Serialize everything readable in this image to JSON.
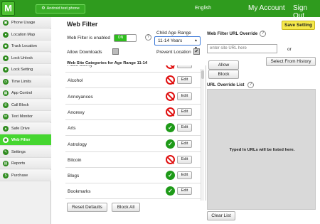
{
  "logo": "M",
  "header": {
    "device": "Android test phone",
    "language": "English",
    "my_account": "My Account",
    "sign_out": "Sign Out"
  },
  "sidebar": {
    "items": [
      {
        "label": "Phone Usage",
        "icon": "phone-icon",
        "glyph": "▣",
        "active": false
      },
      {
        "label": "Location Map",
        "icon": "map-pin-icon",
        "glyph": "●",
        "active": false
      },
      {
        "label": "Track Location",
        "icon": "track-icon",
        "glyph": "◆",
        "active": false
      },
      {
        "label": "Lock Unlock",
        "icon": "lock-icon",
        "glyph": "■",
        "active": false
      },
      {
        "label": "Lock Setting",
        "icon": "lock-setting-icon",
        "glyph": "■",
        "active": false
      },
      {
        "label": "Time Limits",
        "icon": "clock-icon",
        "glyph": "◷",
        "active": false
      },
      {
        "label": "App Control",
        "icon": "app-grid-icon",
        "glyph": "▦",
        "active": false
      },
      {
        "label": "Call Block",
        "icon": "call-block-icon",
        "glyph": "✆",
        "active": false
      },
      {
        "label": "Text Monitor",
        "icon": "text-monitor-icon",
        "glyph": "✉",
        "active": false
      },
      {
        "label": "Safe Drive",
        "icon": "car-icon",
        "glyph": "▲",
        "active": false
      },
      {
        "label": "Web Filter",
        "icon": "web-filter-icon",
        "glyph": "◉",
        "active": true
      },
      {
        "label": "Settings",
        "icon": "wrench-icon",
        "glyph": "✎",
        "active": false
      },
      {
        "label": "Reports",
        "icon": "reports-icon",
        "glyph": "▤",
        "active": false
      },
      {
        "label": "Purchase",
        "icon": "dollar-icon",
        "glyph": "$",
        "active": false
      }
    ]
  },
  "main": {
    "title": "Web Filter",
    "web_filter_enabled_label": "Web Filter is enabled",
    "toggle_on": "ON",
    "allow_downloads_label": "Allow Downloads",
    "allow_downloads_checked": false,
    "age_range_label": "Child Age Range",
    "age_range_value": "11-14 Years",
    "prevent_location_label": "Prevent Location",
    "prevent_location_checked": true,
    "categories_header": "Web Site Categories for Age Range 11-14",
    "categories": [
      {
        "name": "Adult dating",
        "status": "blocked"
      },
      {
        "name": "Alcohol",
        "status": "blocked"
      },
      {
        "name": "Annoyances",
        "status": "blocked"
      },
      {
        "name": "Anorexy",
        "status": "blocked"
      },
      {
        "name": "Arts",
        "status": "allowed"
      },
      {
        "name": "Astrology",
        "status": "allowed"
      },
      {
        "name": "Bitcoin",
        "status": "blocked"
      },
      {
        "name": "Blogs",
        "status": "allowed"
      },
      {
        "name": "Bookmarks",
        "status": "allowed"
      }
    ],
    "edit_label": "Edit",
    "reset_defaults": "Reset Defaults",
    "block_all": "Block All",
    "help_glyph": "?"
  },
  "override": {
    "save_setting": "Save Setting",
    "title": "Web Filter URL Override",
    "input_placeholder": "enter site URL here",
    "or_label": "or",
    "allow": "Allow",
    "block": "Block",
    "select_from_history": "Select From History",
    "list_title": "URL Override List",
    "empty_text": "Typed In URLs will be listed here.",
    "clear_list": "Clear List"
  },
  "colors": {
    "brand_green": "#2f9b1e",
    "active_green": "#45d630",
    "blocked_red": "#e01010",
    "allowed_green": "#1e9a18",
    "save_yellow": "#f6e94a"
  }
}
